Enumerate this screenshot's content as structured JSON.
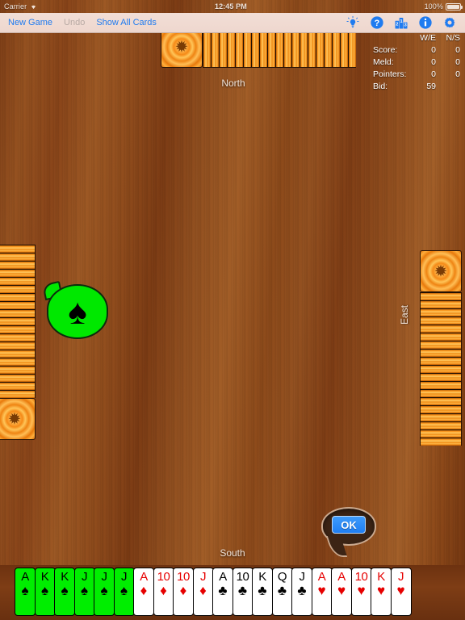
{
  "status_bar": {
    "carrier": "Carrier",
    "wifi_icon": "wifi-icon",
    "time": "12:45 PM",
    "battery_percent": "100%",
    "battery_icon": "battery-icon"
  },
  "toolbar": {
    "new_game_label": "New Game",
    "undo_label": "Undo",
    "undo_disabled": true,
    "show_all_cards_label": "Show All Cards",
    "icons": [
      {
        "name": "hint-lightbulb-icon"
      },
      {
        "name": "help-question-icon"
      },
      {
        "name": "scores-podium-icon"
      },
      {
        "name": "info-icon"
      },
      {
        "name": "settings-gear-icon"
      }
    ],
    "accent_color": "#1f7bf0",
    "disabled_color": "#b7a9a3"
  },
  "scoreboard": {
    "col_headers": [
      "W/E",
      "N/S"
    ],
    "rows": [
      {
        "label": "Score:",
        "we": "0",
        "ns": "0"
      },
      {
        "label": "Meld:",
        "we": "0",
        "ns": "0"
      },
      {
        "label": "Pointers:",
        "we": "0",
        "ns": "0"
      },
      {
        "label": "Bid:",
        "we": "59",
        "ns": ""
      }
    ]
  },
  "table": {
    "north_label": "North",
    "east_label": "East",
    "south_label": "South",
    "north_card_count": 20,
    "east_card_count": 20,
    "west_card_count": 20,
    "card_back_color": "#f08a1a",
    "card_back_icon": "starburst-icon",
    "felt_color": "#8b4a1d"
  },
  "trump_bubble": {
    "suit_symbol": "♠",
    "suit_name": "spades",
    "bubble_color": "#00e800"
  },
  "ok_bubble": {
    "label": "OK",
    "button_color": "#1f7ef2"
  },
  "hand": {
    "cards": [
      {
        "rank": "A",
        "suit": "♠",
        "suit_name": "spades",
        "color": "black",
        "selected": true
      },
      {
        "rank": "K",
        "suit": "♠",
        "suit_name": "spades",
        "color": "black",
        "selected": true
      },
      {
        "rank": "K",
        "suit": "♠",
        "suit_name": "spades",
        "color": "black",
        "selected": true
      },
      {
        "rank": "J",
        "suit": "♠",
        "suit_name": "spades",
        "color": "black",
        "selected": true
      },
      {
        "rank": "J",
        "suit": "♠",
        "suit_name": "spades",
        "color": "black",
        "selected": true
      },
      {
        "rank": "J",
        "suit": "♠",
        "suit_name": "spades",
        "color": "black",
        "selected": true
      },
      {
        "rank": "A",
        "suit": "♦",
        "suit_name": "diamonds",
        "color": "red",
        "selected": false
      },
      {
        "rank": "10",
        "suit": "♦",
        "suit_name": "diamonds",
        "color": "red",
        "selected": false
      },
      {
        "rank": "10",
        "suit": "♦",
        "suit_name": "diamonds",
        "color": "red",
        "selected": false
      },
      {
        "rank": "J",
        "suit": "♦",
        "suit_name": "diamonds",
        "color": "red",
        "selected": false
      },
      {
        "rank": "A",
        "suit": "♣",
        "suit_name": "clubs",
        "color": "black",
        "selected": false
      },
      {
        "rank": "10",
        "suit": "♣",
        "suit_name": "clubs",
        "color": "black",
        "selected": false
      },
      {
        "rank": "K",
        "suit": "♣",
        "suit_name": "clubs",
        "color": "black",
        "selected": false
      },
      {
        "rank": "Q",
        "suit": "♣",
        "suit_name": "clubs",
        "color": "black",
        "selected": false
      },
      {
        "rank": "J",
        "suit": "♣",
        "suit_name": "clubs",
        "color": "black",
        "selected": false
      },
      {
        "rank": "A",
        "suit": "♥",
        "suit_name": "hearts",
        "color": "red",
        "selected": false
      },
      {
        "rank": "A",
        "suit": "♥",
        "suit_name": "hearts",
        "color": "red",
        "selected": false
      },
      {
        "rank": "10",
        "suit": "♥",
        "suit_name": "hearts",
        "color": "red",
        "selected": false
      },
      {
        "rank": "K",
        "suit": "♥",
        "suit_name": "hearts",
        "color": "red",
        "selected": false
      },
      {
        "rank": "J",
        "suit": "♥",
        "suit_name": "hearts",
        "color": "red",
        "selected": false
      }
    ]
  }
}
